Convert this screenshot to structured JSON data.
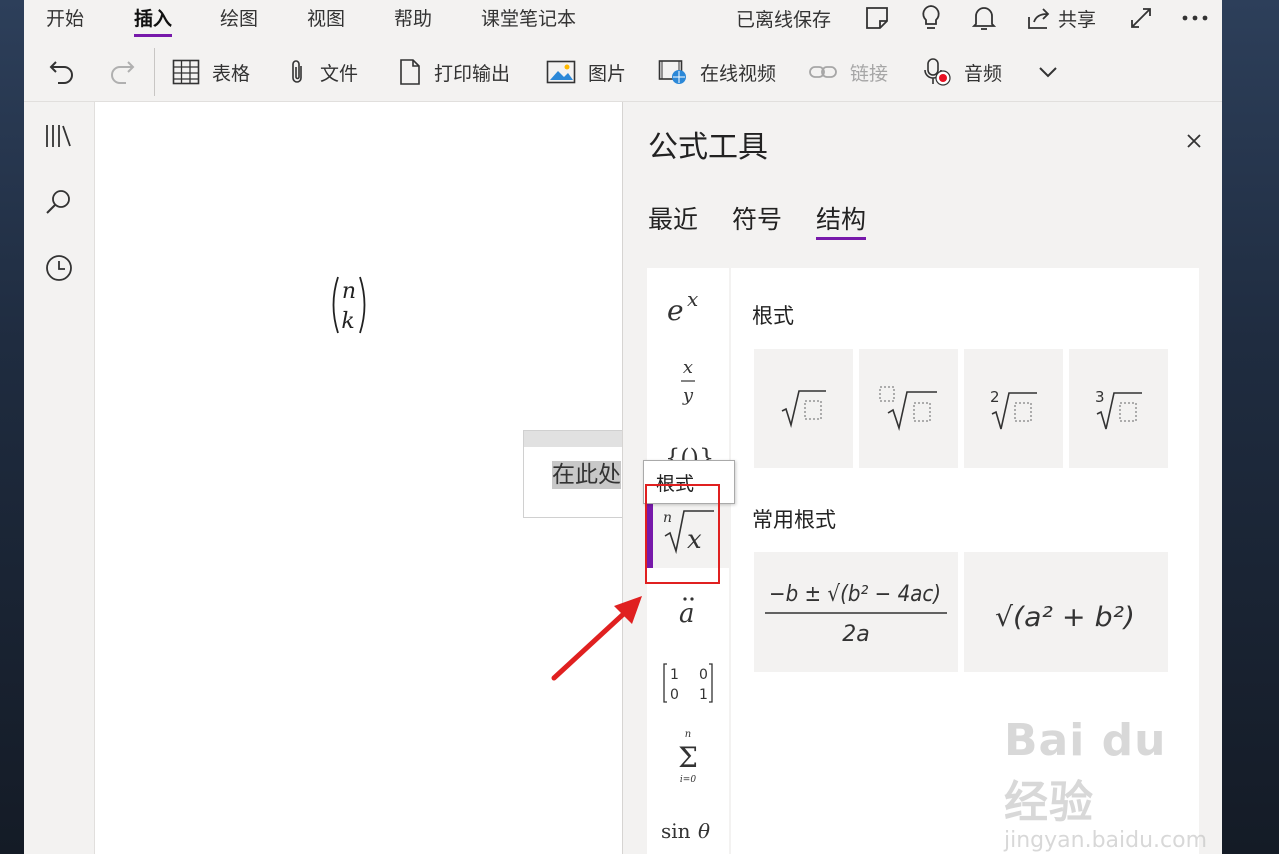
{
  "ribbon": {
    "tabs": [
      "开始",
      "插入",
      "绘图",
      "视图",
      "帮助",
      "课堂笔记本"
    ],
    "active_tab": "插入",
    "offline_status": "已离线保存",
    "share_label": "共享",
    "tools": {
      "table": "表格",
      "file": "文件",
      "printout": "打印输出",
      "picture": "图片",
      "online_video": "在线视频",
      "link": "链接",
      "audio": "音频"
    }
  },
  "canvas": {
    "equation_top": "n",
    "equation_bottom": "k",
    "input_popup_text": "在此处"
  },
  "panel": {
    "title": "公式工具",
    "tabs": [
      "最近",
      "符号",
      "结构"
    ],
    "active_tab": "结构",
    "categories": [
      "e^x",
      "x/y",
      "{()}",
      "ⁿ√x",
      "ä",
      "matrix",
      "Σ",
      "sin θ"
    ],
    "selected_category": "ⁿ√x",
    "section_radicals": "根式",
    "section_common_radicals": "常用根式",
    "radical_index_2": "2",
    "radical_index_3": "3",
    "quadratic_numerator": "−b ± √(b² − 4ac)",
    "quadratic_denominator": "2a",
    "pythag": "√(a² + b²)",
    "tooltip": "根式"
  },
  "colors": {
    "accent": "#7719aa",
    "highlight": "#e02020"
  },
  "watermark": {
    "brand": "Bai du 经验",
    "url": "jingyan.baidu.com"
  }
}
